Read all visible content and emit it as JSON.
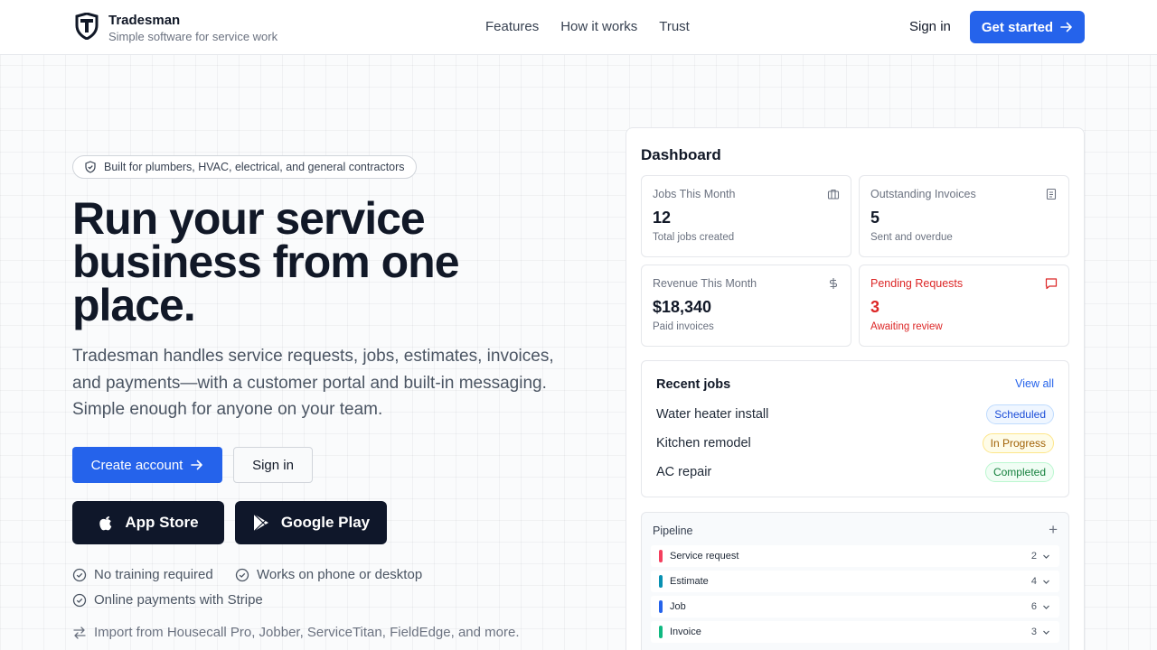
{
  "header": {
    "brand_name": "Tradesman",
    "brand_tagline": "Simple software for service work",
    "nav": [
      "Features",
      "How it works",
      "Trust"
    ],
    "sign_in": "Sign in",
    "get_started": "Get started"
  },
  "hero": {
    "badge": "Built for plumbers, HVAC, electrical, and general contractors",
    "title": "Run your service business from one place.",
    "subtitle": "Tradesman handles service requests, jobs, estimates, invoices, and payments—with a customer portal and built-in messaging. Simple enough for anyone on your team.",
    "create_account": "Create account",
    "sign_in": "Sign in",
    "app_store": "App Store",
    "google_play": "Google Play",
    "checks": [
      "No training required",
      "Works on phone or desktop",
      "Online payments with Stripe"
    ],
    "import": "Import from Housecall Pro, Jobber, ServiceTitan, FieldEdge, and more."
  },
  "dashboard": {
    "title": "Dashboard",
    "stats": [
      {
        "label": "Jobs This Month",
        "value": "12",
        "note": "Total jobs created",
        "icon": "briefcase-icon"
      },
      {
        "label": "Outstanding Invoices",
        "value": "5",
        "note": "Sent and overdue",
        "icon": "receipt-icon"
      },
      {
        "label": "Revenue This Month",
        "value": "$18,340",
        "note": "Paid invoices",
        "icon": "dollar-icon"
      },
      {
        "label": "Pending Requests",
        "value": "3",
        "note": "Awaiting review",
        "icon": "message-icon",
        "color": "#dc2626"
      }
    ],
    "recent_jobs": {
      "title": "Recent jobs",
      "view_all": "View all",
      "jobs": [
        {
          "name": "Water heater install",
          "status": "Scheduled"
        },
        {
          "name": "Kitchen remodel",
          "status": "In Progress"
        },
        {
          "name": "AC repair",
          "status": "Completed"
        }
      ]
    },
    "pipeline": {
      "title": "Pipeline",
      "add": "+",
      "stages": [
        {
          "name": "Service request",
          "count": "2",
          "color": "#f43f5e"
        },
        {
          "name": "Estimate",
          "count": "4",
          "color": "#0891b2"
        },
        {
          "name": "Job",
          "count": "6",
          "color": "#2563eb"
        },
        {
          "name": "Invoice",
          "count": "3",
          "color": "#10b981"
        }
      ]
    }
  },
  "colors": {
    "primary": "#2563eb",
    "dark": "#0f172a",
    "alert": "#dc2626"
  }
}
